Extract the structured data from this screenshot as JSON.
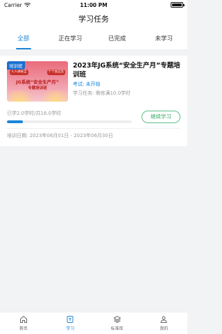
{
  "status_bar": {
    "carrier": "Carrier",
    "time": "11:00 PM"
  },
  "header": {
    "title": "学习任务"
  },
  "tabs": [
    {
      "label": "全部",
      "active": true
    },
    {
      "label": "正在学习",
      "active": false
    },
    {
      "label": "已完成",
      "active": false
    },
    {
      "label": "未学习",
      "active": false
    }
  ],
  "course": {
    "cover_tag": "培训班",
    "cover_badges": [
      "人人讲安全",
      "个个会应急"
    ],
    "cover_title": "JG系统“安全生产月”",
    "cover_subtitle": "专题培训班",
    "title": "2023年JG系统“安全生产月”专题培训班",
    "exam_status": "考试: 未开始",
    "task_requirement": "学习任务: 需修满10.0学时",
    "progress_text": "已学2.0学时/共16.0学时",
    "progress_fraction": 0.125,
    "continue_label": "继续学习",
    "date_range": "培训日期: 2023年06月01日 - 2023年06月30日"
  },
  "tabbar": [
    {
      "label": "首页",
      "icon": "home-icon",
      "active": false
    },
    {
      "label": "学习",
      "icon": "book-icon",
      "active": true
    },
    {
      "label": "标准库",
      "icon": "layers-icon",
      "active": false
    },
    {
      "label": "我的",
      "icon": "user-icon",
      "active": false
    }
  ],
  "colors": {
    "accent": "#1a86d8",
    "continue_border": "#5cbf87"
  }
}
